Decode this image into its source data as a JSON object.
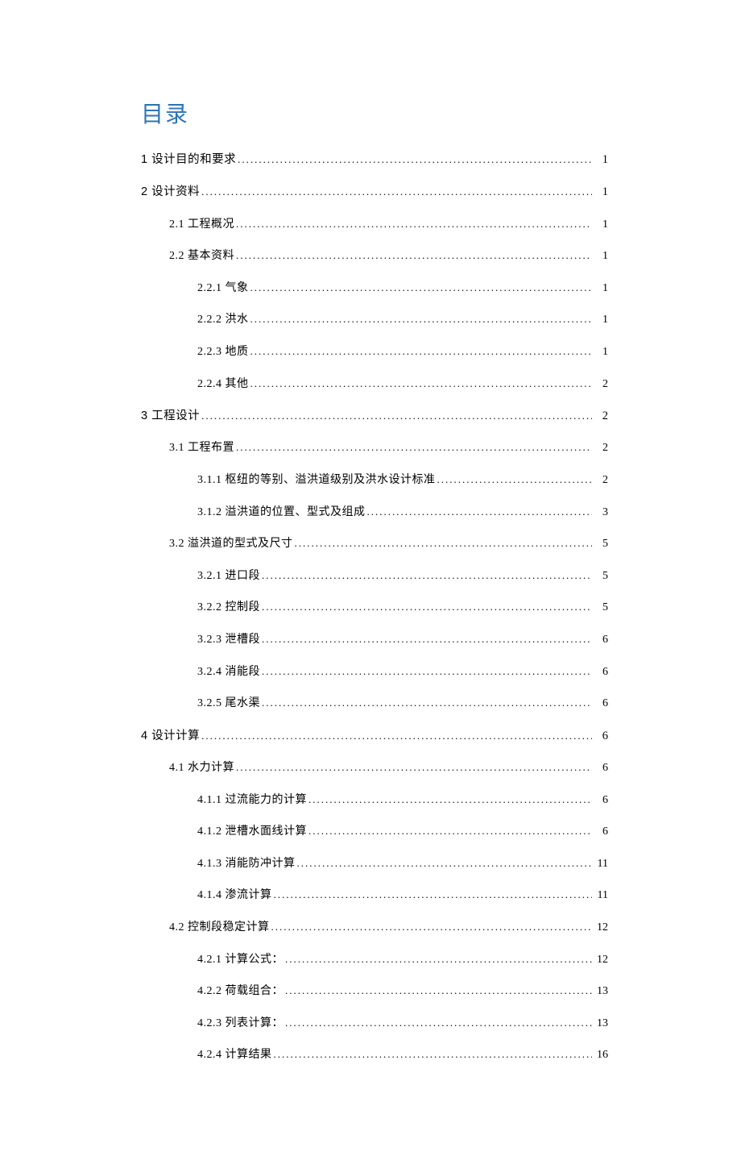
{
  "title": "目录",
  "entries": [
    {
      "level": 0,
      "label": "1 设计目的和要求",
      "page": "1"
    },
    {
      "level": 0,
      "label": "2 设计资料",
      "page": "1"
    },
    {
      "level": 1,
      "label": "2.1 工程概况",
      "page": "1"
    },
    {
      "level": 1,
      "label": "2.2 基本资料",
      "page": "1"
    },
    {
      "level": 2,
      "label": "2.2.1 气象",
      "page": "1"
    },
    {
      "level": 2,
      "label": "2.2.2 洪水",
      "page": "1"
    },
    {
      "level": 2,
      "label": "2.2.3 地质",
      "page": "1"
    },
    {
      "level": 2,
      "label": "2.2.4 其他",
      "page": "2"
    },
    {
      "level": 0,
      "label": "3 工程设计",
      "page": "2"
    },
    {
      "level": 1,
      "label": "3.1 工程布置",
      "page": "2"
    },
    {
      "level": 2,
      "label": "3.1.1 枢纽的等别、溢洪道级别及洪水设计标准",
      "page": "2"
    },
    {
      "level": 2,
      "label": "3.1.2 溢洪道的位置、型式及组成",
      "page": "3"
    },
    {
      "level": 1,
      "label": "3.2 溢洪道的型式及尺寸",
      "page": "5"
    },
    {
      "level": 2,
      "label": "3.2.1 进口段",
      "page": "5"
    },
    {
      "level": 2,
      "label": "3.2.2 控制段",
      "page": "5"
    },
    {
      "level": 2,
      "label": "3.2.3 泄槽段",
      "page": "6"
    },
    {
      "level": 2,
      "label": "3.2.4 消能段",
      "page": "6"
    },
    {
      "level": 2,
      "label": "3.2.5 尾水渠",
      "page": "6"
    },
    {
      "level": 0,
      "label": "4 设计计算",
      "page": "6"
    },
    {
      "level": 1,
      "label": "4.1 水力计算",
      "page": "6"
    },
    {
      "level": 2,
      "label": "4.1.1 过流能力的计算",
      "page": "6"
    },
    {
      "level": 2,
      "label": "4.1.2 泄槽水面线计算",
      "page": "6"
    },
    {
      "level": 2,
      "label": "4.1.3 消能防冲计算",
      "page": "11"
    },
    {
      "level": 2,
      "label": "4.1.4 渗流计算",
      "page": "11"
    },
    {
      "level": 1,
      "label": "4.2 控制段稳定计算",
      "page": "12"
    },
    {
      "level": 2,
      "label": "4.2.1 计算公式：",
      "page": "12"
    },
    {
      "level": 2,
      "label": "4.2.2 荷载组合：",
      "page": "13"
    },
    {
      "level": 2,
      "label": "4.2.3 列表计算：",
      "page": "13"
    },
    {
      "level": 2,
      "label": "4.2.4 计算结果",
      "page": "16"
    }
  ]
}
